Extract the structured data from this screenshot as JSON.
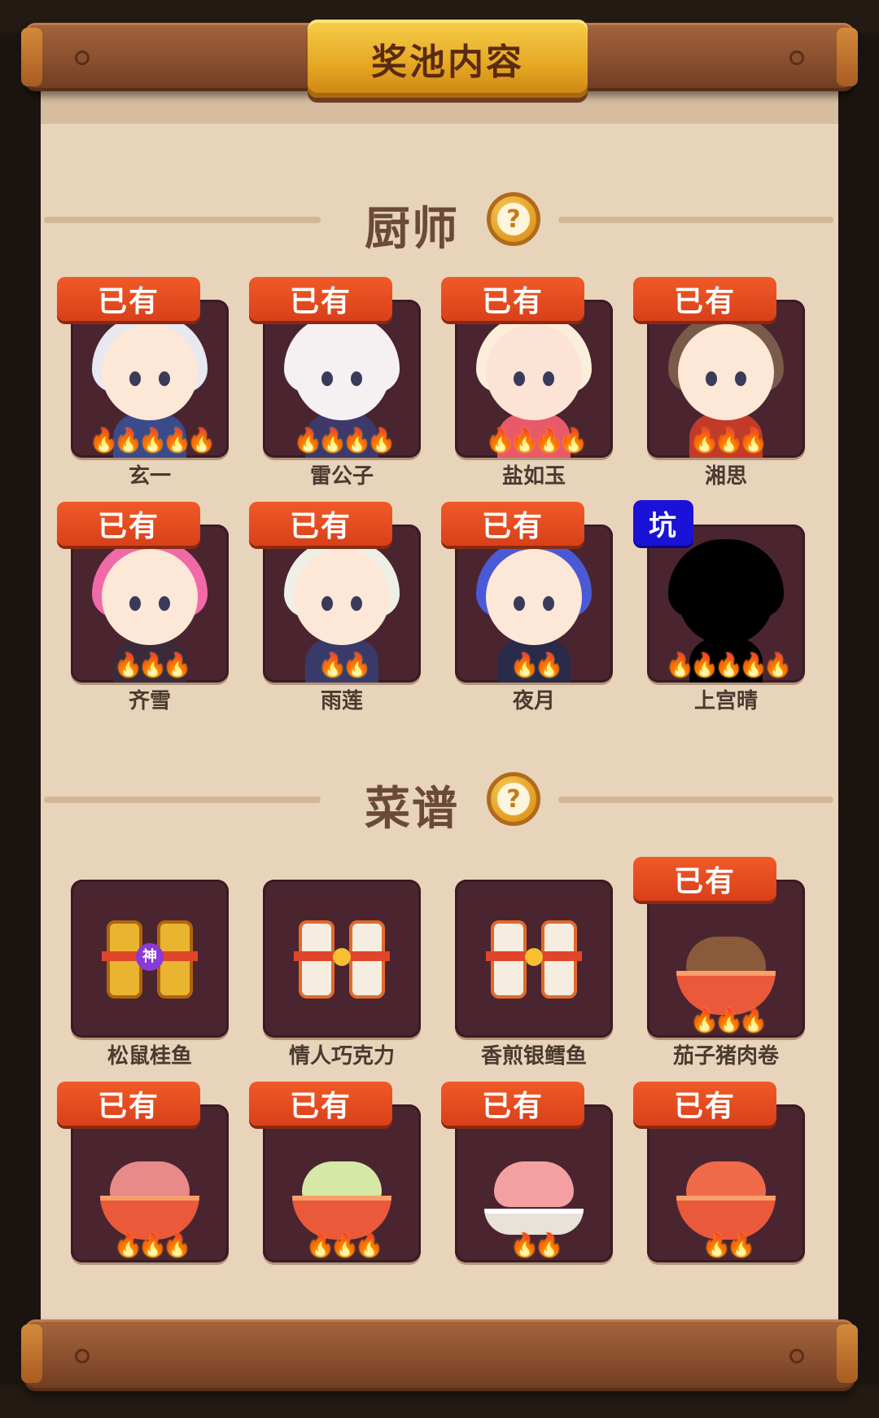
{
  "title": "奖池内容",
  "sections": {
    "chefs": {
      "label": "厨师",
      "help": "?"
    },
    "recipes": {
      "label": "菜谱",
      "help": "?"
    }
  },
  "badges": {
    "owned": "已有",
    "pit": "坑",
    "god": "神"
  },
  "chefs": [
    {
      "name": "玄一",
      "status": "已有",
      "flames": 5,
      "hair": "#e8e8f0",
      "skin": "#fde7d6",
      "outfit": "#3a4a8a"
    },
    {
      "name": "雷公子",
      "status": "已有",
      "flames": 4,
      "hair": "#f5f0f2",
      "skin": "#f5f0f2",
      "outfit": "#3d3a6a"
    },
    {
      "name": "盐如玉",
      "status": "已有",
      "flames": 4,
      "hair": "#fbeeda",
      "skin": "#fde3d6",
      "outfit": "#e85a6a"
    },
    {
      "name": "湘思",
      "status": "已有",
      "flames": 3,
      "hair": "#7a5a4a",
      "skin": "#fde7d6",
      "outfit": "#c23a2a"
    },
    {
      "name": "齐雪",
      "status": "已有",
      "flames": 3,
      "hair": "#f06aa8",
      "skin": "#fde7d6",
      "outfit": "#3a2a3a"
    },
    {
      "name": "雨莲",
      "status": "已有",
      "flames": 2,
      "hair": "#eef0e6",
      "skin": "#fde7d6",
      "outfit": "#3a3a6a"
    },
    {
      "name": "夜月",
      "status": "已有",
      "flames": 2,
      "hair": "#4a5ad6",
      "skin": "#fde7d6",
      "outfit": "#2a2a4a"
    },
    {
      "name": "上宫晴",
      "status": "坑",
      "flames": 5,
      "hair": "#000000",
      "skin": "#000000",
      "outfit": "#000000"
    }
  ],
  "recipes": [
    {
      "name": "松鼠桂鱼",
      "status": "",
      "flames": 0,
      "kind": "god-scroll"
    },
    {
      "name": "情人巧克力",
      "status": "",
      "flames": 0,
      "kind": "scroll"
    },
    {
      "name": "香煎银鳕鱼",
      "status": "",
      "flames": 0,
      "kind": "scroll"
    },
    {
      "name": "茄子猪肉卷",
      "status": "已有",
      "flames": 3,
      "kind": "dish",
      "food": "#8a5a3a"
    },
    {
      "name": "",
      "status": "已有",
      "flames": 3,
      "kind": "dish",
      "food": "#e88a8a"
    },
    {
      "name": "",
      "status": "已有",
      "flames": 3,
      "kind": "dish",
      "food": "#d6e8a6"
    },
    {
      "name": "",
      "status": "已有",
      "flames": 2,
      "kind": "plate",
      "food": "#f4a0a0"
    },
    {
      "name": "",
      "status": "已有",
      "flames": 2,
      "kind": "dish",
      "food": "#f06a4a"
    }
  ]
}
